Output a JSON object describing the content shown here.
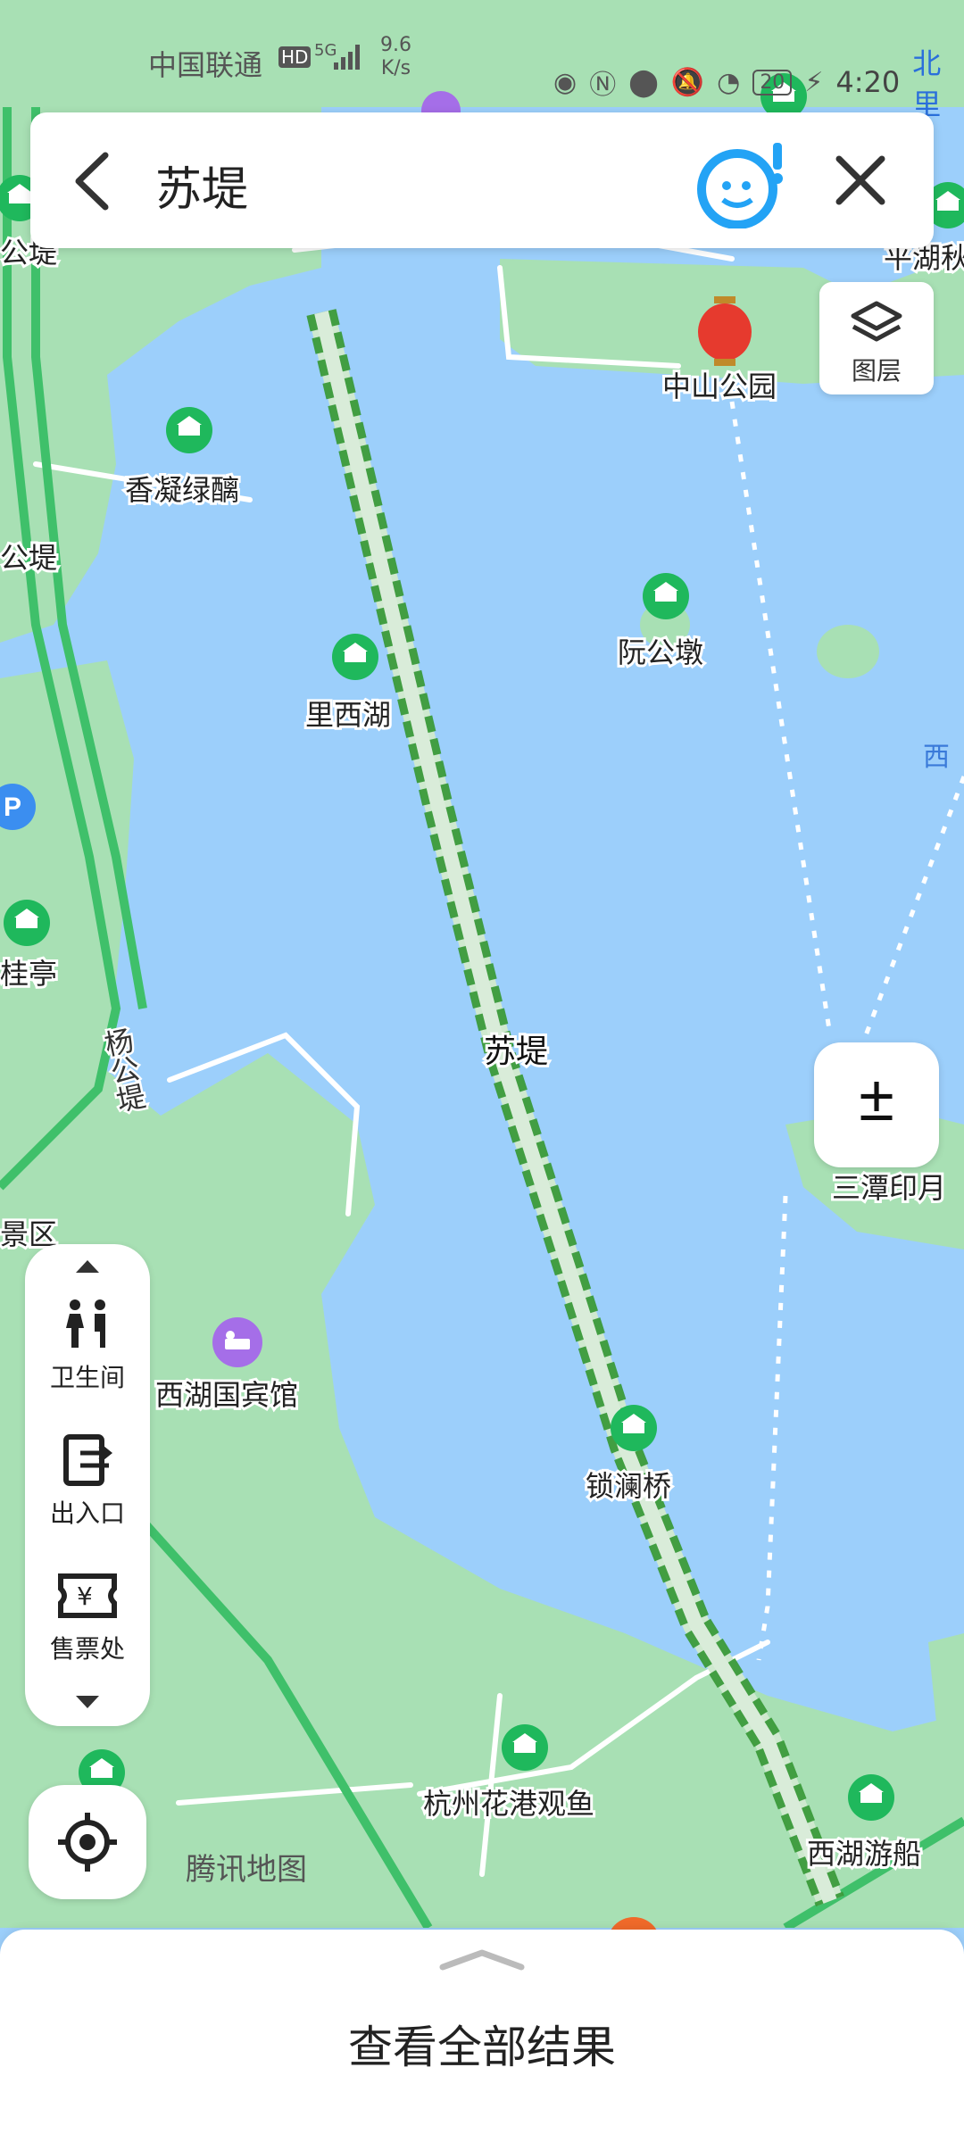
{
  "status_bar": {
    "carrier": "中国联通",
    "network_badge": "HD",
    "signal": "5G",
    "speed_value": "9.6",
    "speed_unit": "K/s",
    "battery": "20",
    "time": "4:20",
    "city": "北里"
  },
  "search": {
    "query": "苏堤"
  },
  "map_controls": {
    "layers_label": "图层",
    "zoom_label": "±"
  },
  "poi_filters": [
    {
      "label": "卫生间",
      "icon": "restroom-icon"
    },
    {
      "label": "出入口",
      "icon": "entrance-exit-icon"
    },
    {
      "label": "售票处",
      "icon": "ticket-icon"
    }
  ],
  "map_labels": {
    "route": "苏堤",
    "zhongshan_park": "中山公园",
    "xiangning": "香凝绿醨",
    "ruangongdun": "阮公墩",
    "lixihu": "里西湖",
    "santanyinyue": "三潭印月",
    "xihu_binguan": "西湖国宾馆",
    "suolanqiao": "锁澜桥",
    "huagang": "杭州花港观鱼",
    "youchuan": "西湖游船",
    "yanggongdi": "杨公堤",
    "pinghu": "平湖秋",
    "left_gongdi": "公堤",
    "left_gongdi2": "公堤",
    "guiting": "桂亭",
    "jingqu": "景区",
    "xi_partial": "西",
    "watermark": "腾讯地图"
  },
  "bottom_sheet": {
    "view_all": "查看全部结果"
  },
  "colors": {
    "water": "#9ccffb",
    "land": "#a8e0b4",
    "route": "#3a9a3a",
    "poi": "#1fb85c"
  }
}
